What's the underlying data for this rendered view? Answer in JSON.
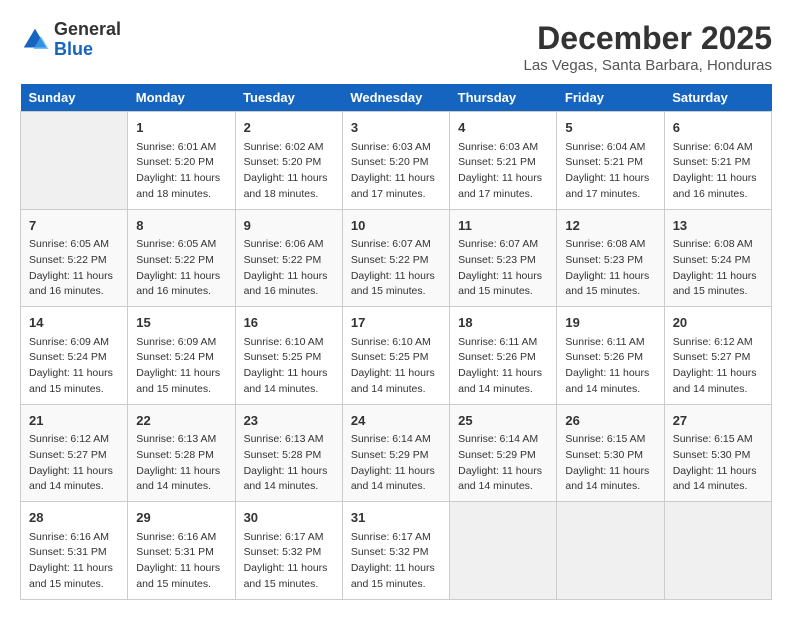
{
  "header": {
    "logo_line1": "General",
    "logo_line2": "Blue",
    "title": "December 2025",
    "subtitle": "Las Vegas, Santa Barbara, Honduras"
  },
  "calendar": {
    "headers": [
      "Sunday",
      "Monday",
      "Tuesday",
      "Wednesday",
      "Thursday",
      "Friday",
      "Saturday"
    ],
    "weeks": [
      [
        {
          "day": "",
          "info": ""
        },
        {
          "day": "1",
          "info": "Sunrise: 6:01 AM\nSunset: 5:20 PM\nDaylight: 11 hours\nand 18 minutes."
        },
        {
          "day": "2",
          "info": "Sunrise: 6:02 AM\nSunset: 5:20 PM\nDaylight: 11 hours\nand 18 minutes."
        },
        {
          "day": "3",
          "info": "Sunrise: 6:03 AM\nSunset: 5:20 PM\nDaylight: 11 hours\nand 17 minutes."
        },
        {
          "day": "4",
          "info": "Sunrise: 6:03 AM\nSunset: 5:21 PM\nDaylight: 11 hours\nand 17 minutes."
        },
        {
          "day": "5",
          "info": "Sunrise: 6:04 AM\nSunset: 5:21 PM\nDaylight: 11 hours\nand 17 minutes."
        },
        {
          "day": "6",
          "info": "Sunrise: 6:04 AM\nSunset: 5:21 PM\nDaylight: 11 hours\nand 16 minutes."
        }
      ],
      [
        {
          "day": "7",
          "info": "Sunrise: 6:05 AM\nSunset: 5:22 PM\nDaylight: 11 hours\nand 16 minutes."
        },
        {
          "day": "8",
          "info": "Sunrise: 6:05 AM\nSunset: 5:22 PM\nDaylight: 11 hours\nand 16 minutes."
        },
        {
          "day": "9",
          "info": "Sunrise: 6:06 AM\nSunset: 5:22 PM\nDaylight: 11 hours\nand 16 minutes."
        },
        {
          "day": "10",
          "info": "Sunrise: 6:07 AM\nSunset: 5:22 PM\nDaylight: 11 hours\nand 15 minutes."
        },
        {
          "day": "11",
          "info": "Sunrise: 6:07 AM\nSunset: 5:23 PM\nDaylight: 11 hours\nand 15 minutes."
        },
        {
          "day": "12",
          "info": "Sunrise: 6:08 AM\nSunset: 5:23 PM\nDaylight: 11 hours\nand 15 minutes."
        },
        {
          "day": "13",
          "info": "Sunrise: 6:08 AM\nSunset: 5:24 PM\nDaylight: 11 hours\nand 15 minutes."
        }
      ],
      [
        {
          "day": "14",
          "info": "Sunrise: 6:09 AM\nSunset: 5:24 PM\nDaylight: 11 hours\nand 15 minutes."
        },
        {
          "day": "15",
          "info": "Sunrise: 6:09 AM\nSunset: 5:24 PM\nDaylight: 11 hours\nand 15 minutes."
        },
        {
          "day": "16",
          "info": "Sunrise: 6:10 AM\nSunset: 5:25 PM\nDaylight: 11 hours\nand 14 minutes."
        },
        {
          "day": "17",
          "info": "Sunrise: 6:10 AM\nSunset: 5:25 PM\nDaylight: 11 hours\nand 14 minutes."
        },
        {
          "day": "18",
          "info": "Sunrise: 6:11 AM\nSunset: 5:26 PM\nDaylight: 11 hours\nand 14 minutes."
        },
        {
          "day": "19",
          "info": "Sunrise: 6:11 AM\nSunset: 5:26 PM\nDaylight: 11 hours\nand 14 minutes."
        },
        {
          "day": "20",
          "info": "Sunrise: 6:12 AM\nSunset: 5:27 PM\nDaylight: 11 hours\nand 14 minutes."
        }
      ],
      [
        {
          "day": "21",
          "info": "Sunrise: 6:12 AM\nSunset: 5:27 PM\nDaylight: 11 hours\nand 14 minutes."
        },
        {
          "day": "22",
          "info": "Sunrise: 6:13 AM\nSunset: 5:28 PM\nDaylight: 11 hours\nand 14 minutes."
        },
        {
          "day": "23",
          "info": "Sunrise: 6:13 AM\nSunset: 5:28 PM\nDaylight: 11 hours\nand 14 minutes."
        },
        {
          "day": "24",
          "info": "Sunrise: 6:14 AM\nSunset: 5:29 PM\nDaylight: 11 hours\nand 14 minutes."
        },
        {
          "day": "25",
          "info": "Sunrise: 6:14 AM\nSunset: 5:29 PM\nDaylight: 11 hours\nand 14 minutes."
        },
        {
          "day": "26",
          "info": "Sunrise: 6:15 AM\nSunset: 5:30 PM\nDaylight: 11 hours\nand 14 minutes."
        },
        {
          "day": "27",
          "info": "Sunrise: 6:15 AM\nSunset: 5:30 PM\nDaylight: 11 hours\nand 14 minutes."
        }
      ],
      [
        {
          "day": "28",
          "info": "Sunrise: 6:16 AM\nSunset: 5:31 PM\nDaylight: 11 hours\nand 15 minutes."
        },
        {
          "day": "29",
          "info": "Sunrise: 6:16 AM\nSunset: 5:31 PM\nDaylight: 11 hours\nand 15 minutes."
        },
        {
          "day": "30",
          "info": "Sunrise: 6:17 AM\nSunset: 5:32 PM\nDaylight: 11 hours\nand 15 minutes."
        },
        {
          "day": "31",
          "info": "Sunrise: 6:17 AM\nSunset: 5:32 PM\nDaylight: 11 hours\nand 15 minutes."
        },
        {
          "day": "",
          "info": ""
        },
        {
          "day": "",
          "info": ""
        },
        {
          "day": "",
          "info": ""
        }
      ]
    ]
  }
}
